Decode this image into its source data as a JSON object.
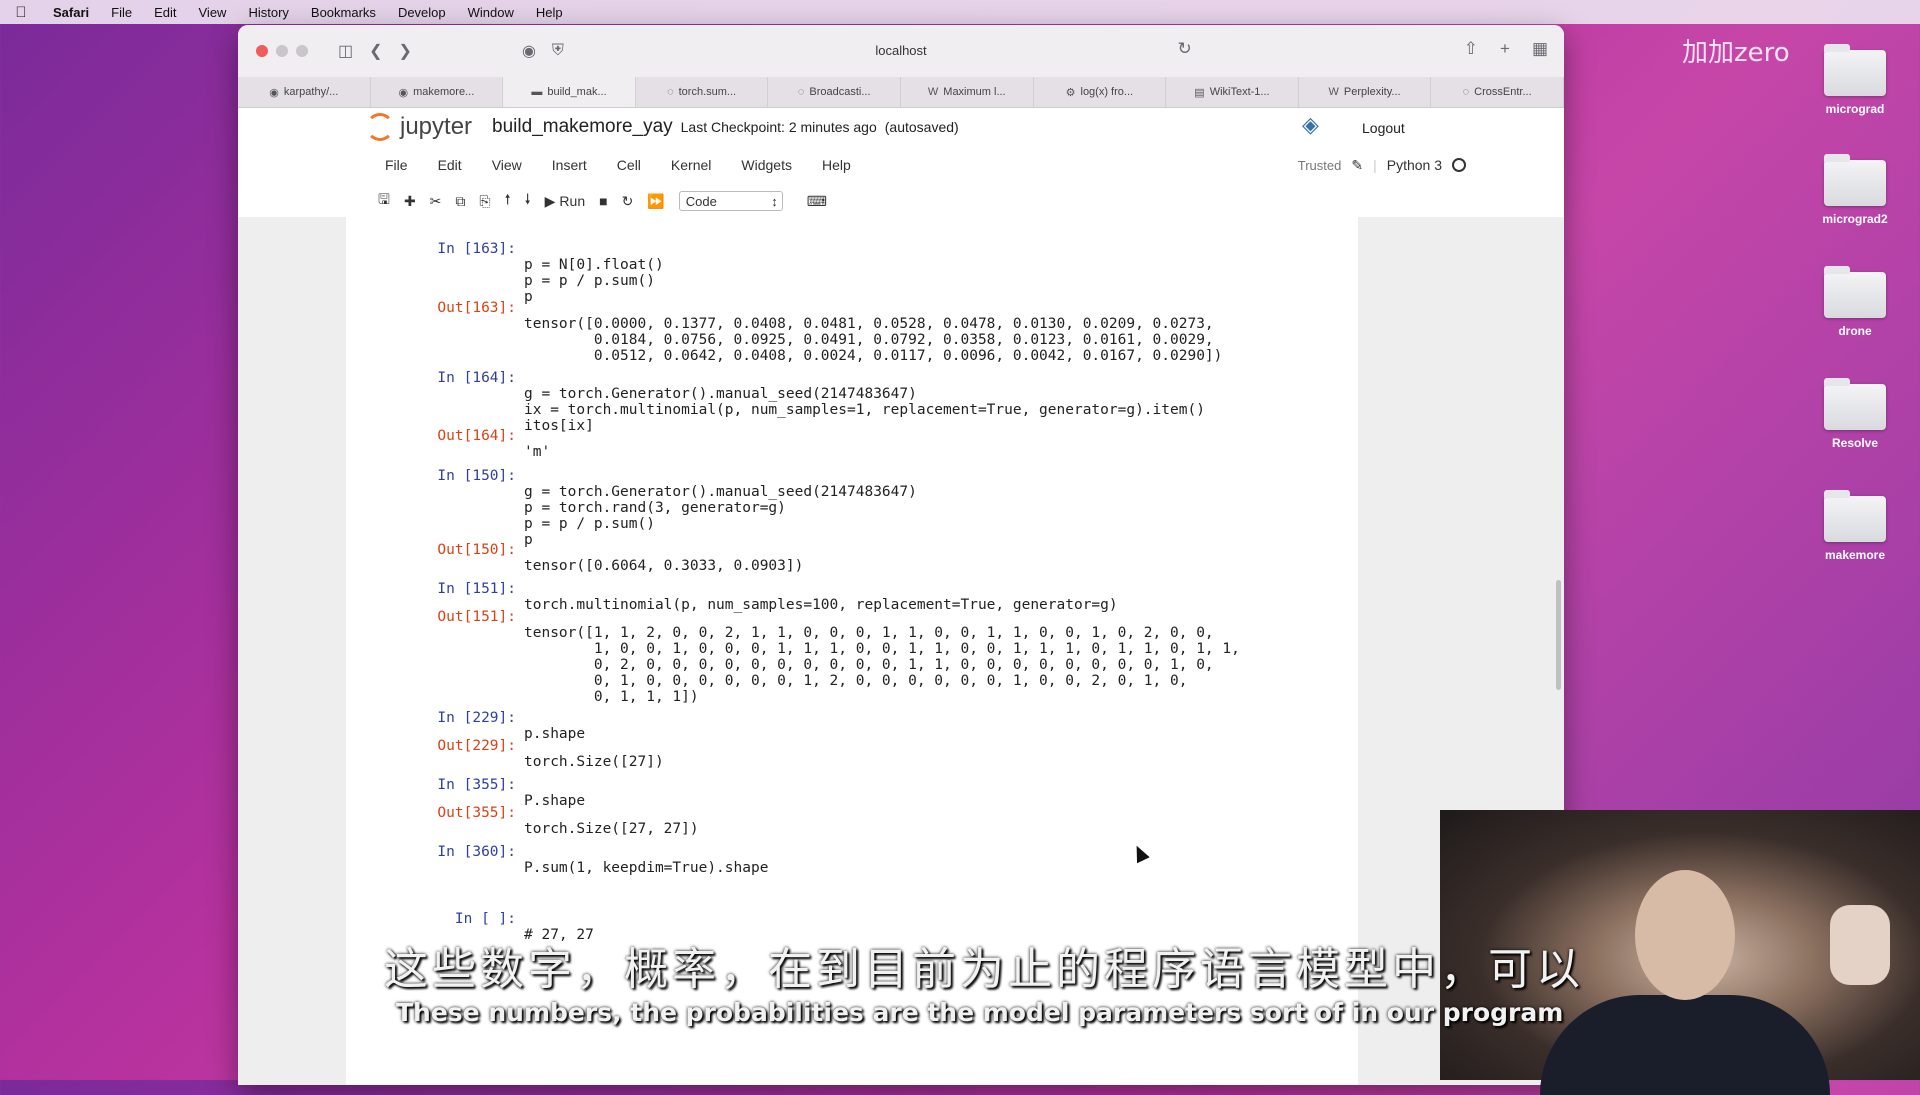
{
  "menubar": {
    "apple_icon": "apple-icon",
    "items": [
      "Safari",
      "File",
      "Edit",
      "View",
      "History",
      "Bookmarks",
      "Develop",
      "Window",
      "Help"
    ]
  },
  "watermark": "加加zero",
  "desktop": {
    "folders": [
      "micrograd",
      "micrograd2",
      "drone",
      "Resolve",
      "makemore"
    ]
  },
  "browser": {
    "url": "localhost",
    "tabs": [
      "karpathy/...",
      "makemore...",
      "build_mak...",
      "torch.sum...",
      "Broadcasti...",
      "Maximum l...",
      "log(x) fro...",
      "WikiText-1...",
      "Perplexity...",
      "CrossEntr..."
    ]
  },
  "jupyter": {
    "logo_text": "jupyter",
    "notebook_name": "build_makemore_yay",
    "checkpoint": "Last Checkpoint: 2 minutes ago",
    "autosave": "(autosaved)",
    "logout": "Logout",
    "menu": [
      "File",
      "Edit",
      "View",
      "Insert",
      "Cell",
      "Kernel",
      "Widgets",
      "Help"
    ],
    "trusted": "Trusted",
    "kernel_name": "Python 3",
    "run_label": "Run",
    "cell_type": "Code"
  },
  "cells": [
    {
      "prompt": "In [163]:",
      "code": "p = N[0].float()\np = p / p.sum()\np"
    },
    {
      "prompt": "Out[163]:",
      "code": "tensor([0.0000, 0.1377, 0.0408, 0.0481, 0.0528, 0.0478, 0.0130, 0.0209, 0.0273,\n        0.0184, 0.0756, 0.0925, 0.0491, 0.0792, 0.0358, 0.0123, 0.0161, 0.0029,\n        0.0512, 0.0642, 0.0408, 0.0024, 0.0117, 0.0096, 0.0042, 0.0167, 0.0290])"
    },
    {
      "prompt": "In [164]:",
      "code": "g = torch.Generator().manual_seed(2147483647)\nix = torch.multinomial(p, num_samples=1, replacement=True, generator=g).item()\nitos[ix]"
    },
    {
      "prompt": "Out[164]:",
      "code": "'m'"
    },
    {
      "prompt": "In [150]:",
      "code": "g = torch.Generator().manual_seed(2147483647)\np = torch.rand(3, generator=g)\np = p / p.sum()\np"
    },
    {
      "prompt": "Out[150]:",
      "code": "tensor([0.6064, 0.3033, 0.0903])"
    },
    {
      "prompt": "In [151]:",
      "code": "torch.multinomial(p, num_samples=100, replacement=True, generator=g)"
    },
    {
      "prompt": "Out[151]:",
      "code": "tensor([1, 1, 2, 0, 0, 2, 1, 1, 0, 0, 0, 1, 1, 0, 0, 1, 1, 0, 0, 1, 0, 2, 0, 0,\n        1, 0, 0, 1, 0, 0, 0, 1, 1, 1, 0, 0, 1, 1, 0, 0, 1, 1, 1, 0, 1, 1, 0, 1, 1,\n        0, 2, 0, 0, 0, 0, 0, 0, 0, 0, 0, 0, 1, 1, 0, 0, 0, 0, 0, 0, 0, 0, 1, 0,\n        0, 1, 0, 0, 0, 0, 0, 0, 1, 2, 0, 0, 0, 0, 0, 0, 1, 0, 0, 2, 0, 1, 0,\n        0, 1, 1, 1])"
    },
    {
      "prompt": "In [229]:",
      "code": "p.shape"
    },
    {
      "prompt": "Out[229]:",
      "code": "torch.Size([27])"
    },
    {
      "prompt": "In [355]:",
      "code": "P.shape"
    },
    {
      "prompt": "Out[355]:",
      "code": "torch.Size([27, 27])"
    },
    {
      "prompt": "In [360]:",
      "code": "P.sum(1, keepdim=True).shape"
    },
    {
      "prompt": "In [ ]:",
      "code": "# 27, 27"
    }
  ],
  "subtitles": {
    "cn": "这些数字，概率，在到目前为止的程序语言模型中，可以",
    "en": "These numbers, the probabilities are the model parameters sort of in our program"
  }
}
